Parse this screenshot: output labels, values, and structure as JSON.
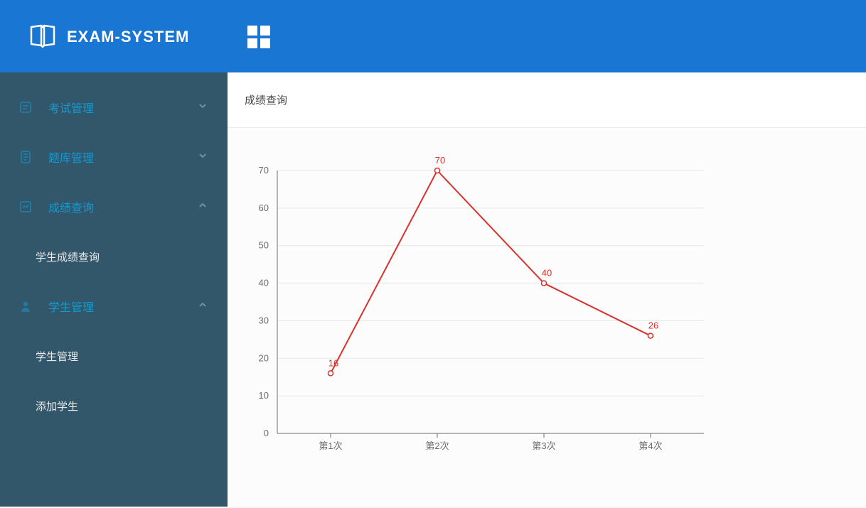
{
  "brand": {
    "name": "EXAM-SYSTEM"
  },
  "icons": {
    "logo": "book-open-icon",
    "apps": "apps-grid-icon"
  },
  "sidebar": {
    "items": [
      {
        "label": "考试管理",
        "icon": "exam-icon",
        "expanded": false,
        "children": []
      },
      {
        "label": "题库管理",
        "icon": "bank-icon",
        "expanded": false,
        "children": []
      },
      {
        "label": "成绩查询",
        "icon": "score-icon",
        "expanded": true,
        "children": [
          {
            "label": "学生成绩查询"
          }
        ]
      },
      {
        "label": "学生管理",
        "icon": "student-icon",
        "expanded": true,
        "children": [
          {
            "label": "学生管理"
          },
          {
            "label": "添加学生"
          }
        ]
      }
    ]
  },
  "page": {
    "title": "成绩查询"
  },
  "chart_data": {
    "type": "line",
    "categories": [
      "第1次",
      "第2次",
      "第3次",
      "第4次"
    ],
    "values": [
      16,
      70,
      40,
      26
    ],
    "ylim": [
      0,
      70
    ],
    "ystep": 10,
    "title": "",
    "xlabel": "",
    "ylabel": "",
    "series_color": "#d7322e",
    "show_point_labels": true
  }
}
